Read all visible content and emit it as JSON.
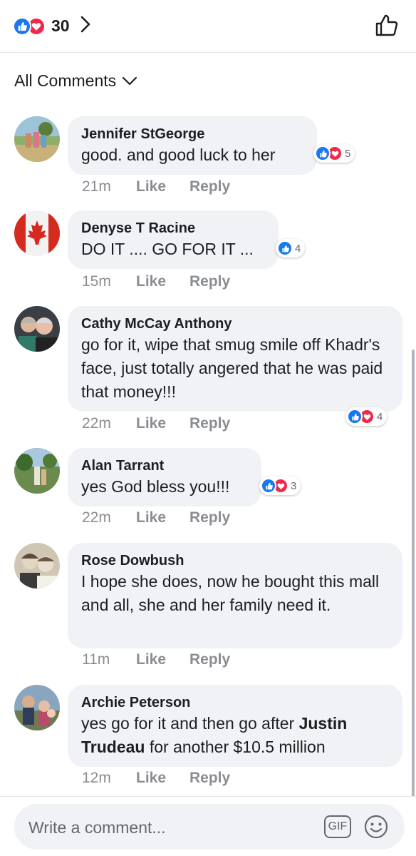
{
  "header": {
    "reaction_count": "30",
    "reaction_icons": [
      "like-icon",
      "love-icon"
    ]
  },
  "filter": {
    "label": "All Comments"
  },
  "comments": [
    {
      "name": "Jennifer StGeorge",
      "text": "good. and good luck to her",
      "time": "21m",
      "like": "Like",
      "reply": "Reply",
      "reactions": {
        "icons": [
          "like-icon",
          "love-icon"
        ],
        "count": "5"
      }
    },
    {
      "name": "Denyse T Racine",
      "text": "DO IT .... GO FOR IT ...",
      "time": "15m",
      "like": "Like",
      "reply": "Reply",
      "reactions": {
        "icons": [
          "like-icon"
        ],
        "count": "4"
      }
    },
    {
      "name": "Cathy McCay Anthony",
      "text": "go for it, wipe that smug smile off Khadr's face, just totally angered that he was paid that money!!!",
      "time": "22m",
      "like": "Like",
      "reply": "Reply",
      "reactions": {
        "icons": [
          "like-icon",
          "love-icon"
        ],
        "count": "4"
      }
    },
    {
      "name": "Alan Tarrant",
      "text": "yes God bless you!!!",
      "time": "22m",
      "like": "Like",
      "reply": "Reply",
      "reactions": {
        "icons": [
          "like-icon",
          "love-icon"
        ],
        "count": "3"
      }
    },
    {
      "name": "Rose Dowbush",
      "text": "I hope she does, now he bought this mall and all, she and her family need it.",
      "time": "11m",
      "like": "Like",
      "reply": "Reply"
    },
    {
      "name": "Archie Peterson",
      "text_before": "yes go for it and then go after ",
      "text_mention": "Justin Trudeau",
      "text_after": " for another $10.5 million",
      "time": "12m",
      "like": "Like",
      "reply": "Reply"
    }
  ],
  "composer": {
    "placeholder": "Write a comment...",
    "gif_label": "GIF"
  },
  "colors": {
    "like_blue": "#1877f2",
    "love_red": "#f0284a",
    "bubble_bg": "#f0f2f5",
    "meta_gray": "#8a8d91"
  }
}
